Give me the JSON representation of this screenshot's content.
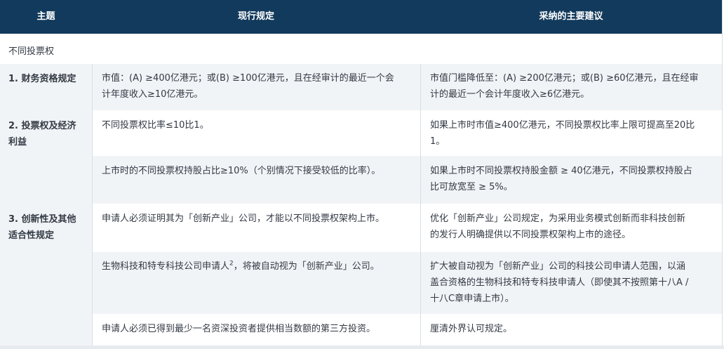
{
  "header": {
    "col_topic": "主题",
    "col_current": "现行规定",
    "col_proposed": "采纳的主要建议"
  },
  "section_title": "不同投票权",
  "topics": {
    "t1": "1. 财务资格规定",
    "t2a": "2. 投票权及经济",
    "t2b": "利益",
    "t3a": "3. 创新性及其他",
    "t3b": "适合性规定"
  },
  "rows": [
    {
      "current_1": "市值：(A) ≥400亿港元；或(B) ≥100亿港元，且在经审计的最近一个会",
      "current_2": "计年度收入≥10亿港元。",
      "proposed_1": "市值门槛降低至：(A) ≥200亿港元；或(B) ≥60亿港元，且在经审",
      "proposed_2": "计的最近一个会计年度收入≥6亿港元。"
    },
    {
      "current_1": "不同投票权比率≤10比1。",
      "proposed_1": "如果上市时市值≥400亿港元，不同投票权比率上限可提高至20比",
      "proposed_2": "1。"
    },
    {
      "current_1": "上市时的不同投票权持股占比≥10%（个别情况下接受较低的比率）。",
      "proposed_1": "如果上市时不同投票权持股金额 ≥ 40亿港元，不同投票权持股占",
      "proposed_2": "比可放宽至 ≥ 5%。"
    },
    {
      "current_1": "申请人必须证明其为「创新产业」公司，才能以不同投票权架构上市。",
      "proposed_1": "优化「创新产业」公司规定，为采用业务模式创新而非科技创新",
      "proposed_2": "的发行人明确提供以不同投票权架构上市的途径。"
    },
    {
      "current_1a": "生物科技和特专科技公司申请人",
      "current_1sup": "2",
      "current_1b": "，将被自动视为「创新产业」公司。",
      "proposed_1": "扩大被自动视为「创新产业」公司的科技公司申请人范围，以涵",
      "proposed_2": "盖合资格的生物科技和特专科技申请人（即使其不按照第十八A /",
      "proposed_3": "十八C章申请上市）。"
    },
    {
      "current_1": "申请人必须已得到最少一名资深投资者提供相当数额的第三方投资。",
      "proposed_1": "厘清外界认可规定。"
    }
  ]
}
